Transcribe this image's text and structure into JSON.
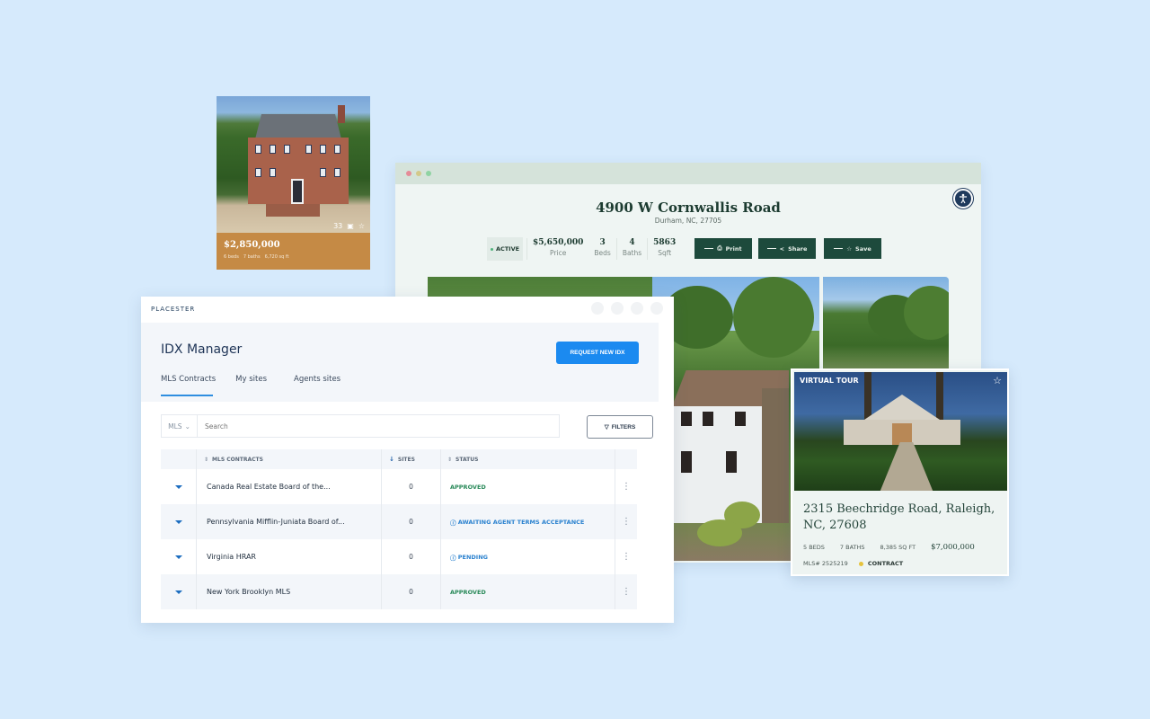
{
  "mini_listing": {
    "price": "$2,850,000",
    "beds": "6 beds",
    "baths": "7 baths",
    "sqft": "6,720 sq ft",
    "photo_count": "33",
    "gallery_icon": "image-icon",
    "favorite_icon": "star-icon"
  },
  "property_page": {
    "window_dots": [
      "#e58c98",
      "#d3c98a",
      "#8fd3a2"
    ],
    "accessibility_icon": "accessibility-icon",
    "title": "4900 W Cornwallis Road",
    "subtitle": "Durham, NC, 27705",
    "status_label": "ACTIVE",
    "stats": [
      {
        "value": "$5,650,000",
        "label": "Price"
      },
      {
        "value": "3",
        "label": "Beds"
      },
      {
        "value": "4",
        "label": "Baths"
      },
      {
        "value": "5863",
        "label": "Sqft"
      }
    ],
    "actions": [
      {
        "label": "Print",
        "icon": "printer-icon"
      },
      {
        "label": "Share",
        "icon": "share-icon"
      },
      {
        "label": "Save",
        "icon": "star-icon"
      }
    ]
  },
  "virtual_tour_card": {
    "badge": "VIRTUAL TOUR",
    "title": "2315 Beechridge Road, Raleigh, NC, 27608",
    "beds": "5 BEDS",
    "baths": "7 BATHS",
    "sqft": "8,385 SQ FT",
    "price": "$7,000,000",
    "mls": "MLS# 2525219",
    "status": "CONTRACT",
    "status_color": "#e6c23c"
  },
  "idx_manager": {
    "brand": "PLACESTER",
    "title": "IDX Manager",
    "request_button": "REQUEST NEW IDX",
    "tabs": [
      {
        "label": "MLS Contracts",
        "active": true
      },
      {
        "label": "My sites",
        "active": false
      },
      {
        "label": "Agents sites",
        "active": false
      }
    ],
    "search": {
      "scope": "MLS",
      "placeholder": "Search"
    },
    "filters_button": "FILTERS",
    "columns": [
      "MLS CONTRACTS",
      "SITES",
      "STATUS"
    ],
    "rows": [
      {
        "name": "Canada Real Estate Board of the...",
        "sites": "0",
        "status": "APPROVED",
        "status_type": "approved"
      },
      {
        "name": "Pennsylvania Mifflin-Juniata Board of...",
        "sites": "0",
        "status": "AWAITING AGENT TERMS ACCEPTANCE",
        "status_type": "awaiting"
      },
      {
        "name": "Virginia HRAR",
        "sites": "0",
        "status": "PENDING",
        "status_type": "pending"
      },
      {
        "name": "New York Brooklyn MLS",
        "sites": "0",
        "status": "APPROVED",
        "status_type": "approved"
      }
    ],
    "colors": {
      "primary": "#1b8af0",
      "approved": "#2a8a5a",
      "pending": "#2b82cf"
    }
  }
}
